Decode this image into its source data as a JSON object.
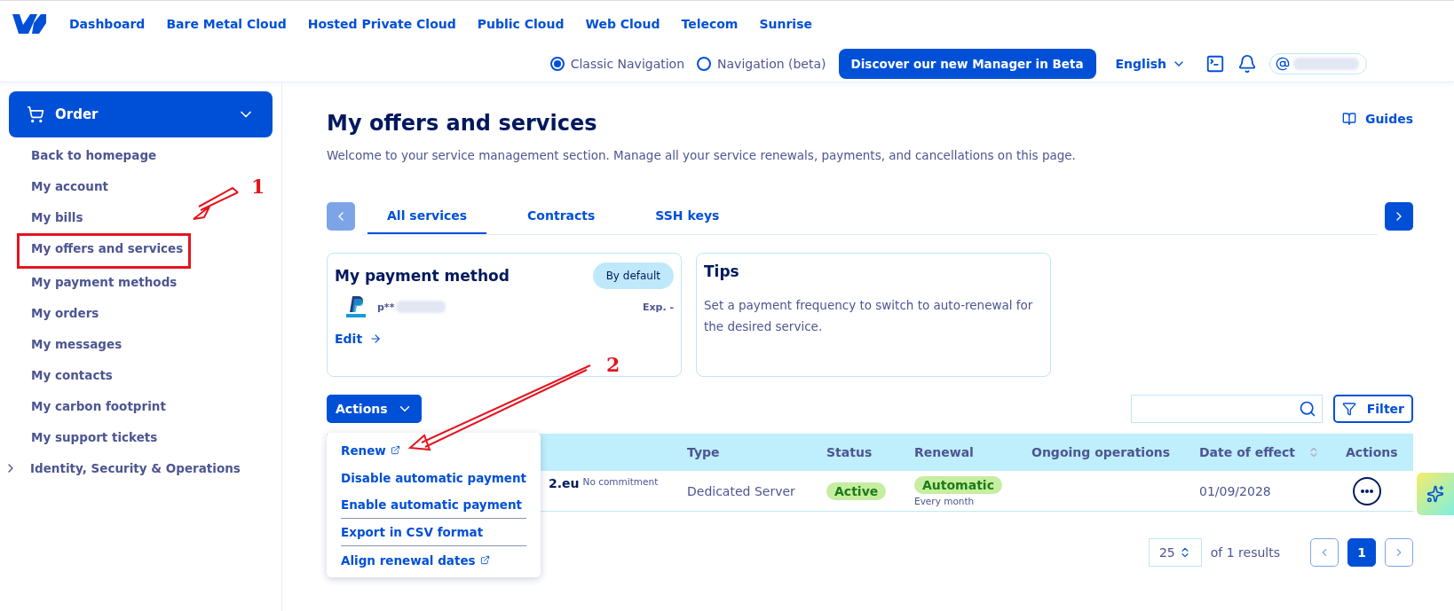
{
  "top_nav": {
    "links": [
      "Dashboard",
      "Bare Metal Cloud",
      "Hosted Private Cloud",
      "Public Cloud",
      "Web Cloud",
      "Telecom",
      "Sunrise"
    ]
  },
  "nav_mode": [
    {
      "label": "Classic Navigation",
      "selected": true
    },
    {
      "label": "Navigation (beta)",
      "selected": false
    }
  ],
  "beta_button": "Discover our new Manager in Beta",
  "language": "English",
  "sidebar": {
    "order_button": "Order",
    "expanded": true,
    "items": [
      {
        "label": "Back to homepage",
        "annotated": false
      },
      {
        "label": "My account",
        "annotated": false
      },
      {
        "label": "My bills",
        "annotated": false
      },
      {
        "label": "My offers and services",
        "annotated": true
      },
      {
        "label": "My payment methods",
        "annotated": false
      },
      {
        "label": "My orders",
        "annotated": false
      },
      {
        "label": "My messages",
        "annotated": false
      },
      {
        "label": "My contacts",
        "annotated": false
      },
      {
        "label": "My carbon footprint",
        "annotated": false
      },
      {
        "label": "My support tickets",
        "annotated": false
      }
    ],
    "group": {
      "label": "Identity, Security & Operations",
      "expanded": false
    }
  },
  "page": {
    "title": "My offers and services",
    "subtitle": "Welcome to your service management section. Manage all your service renewals, payments, and cancellations on this page.",
    "guides": "Guides"
  },
  "tabs": [
    {
      "label": "All services",
      "selected": true
    },
    {
      "label": "Contracts",
      "selected": false
    },
    {
      "label": "SSH keys",
      "selected": false
    }
  ],
  "payment_card": {
    "title": "My payment method",
    "badge": "By default",
    "account": "p**",
    "expiry": "Exp. -",
    "edit": "Edit"
  },
  "tips_card": {
    "title": "Tips",
    "text": "Set a payment frequency to switch to auto-renewal for the desired service."
  },
  "actions_button": "Actions",
  "actions_menu": [
    {
      "label": "Renew",
      "external": true,
      "divider": false
    },
    {
      "label": "Disable automatic payment",
      "external": false,
      "divider": false
    },
    {
      "label": "Enable automatic payment",
      "external": false,
      "divider": true
    },
    {
      "label": "Export in CSV format",
      "external": false,
      "divider": true
    },
    {
      "label": "Align renewal dates",
      "external": true,
      "divider": false
    }
  ],
  "filter_button": "Filter",
  "table": {
    "columns": [
      "Type",
      "Status",
      "Renewal",
      "Ongoing operations",
      "Date of effect",
      "Actions"
    ],
    "rows": [
      {
        "service": "2.eu",
        "commitment": "No commitment",
        "type": "Dedicated Server",
        "status": "Active",
        "renewal": "Automatic",
        "renewal_period": "Every month",
        "date": "01/09/2028"
      }
    ]
  },
  "pagination": {
    "page_size": "25",
    "results": "of 1 results",
    "pages": [
      {
        "label": "1",
        "selected": true
      }
    ]
  },
  "annotations": [
    "1",
    "2"
  ]
}
